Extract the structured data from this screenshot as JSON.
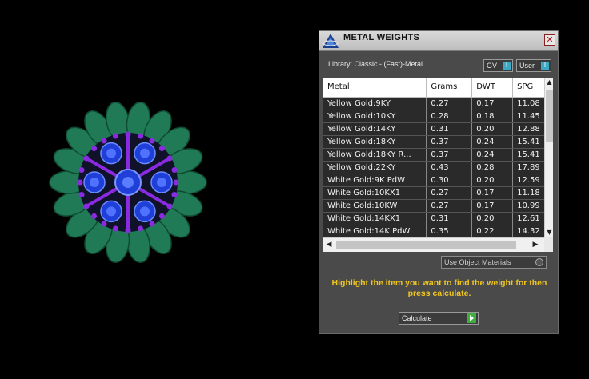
{
  "panel": {
    "title": "METAL WEIGHTS",
    "close_icon": "close-icon",
    "library_label": "Library: Classic - (Fast)-Metal",
    "toggles": [
      {
        "label": "GV",
        "state_glyph": "I"
      },
      {
        "label": "User",
        "state_glyph": "I"
      }
    ],
    "table": {
      "headers": [
        "Metal",
        "Grams",
        "DWT",
        "SPG"
      ],
      "rows": [
        [
          "Yellow Gold:9KY",
          "0.27",
          "0.17",
          "11.08"
        ],
        [
          "Yellow Gold:10KY",
          "0.28",
          "0.18",
          "11.45"
        ],
        [
          "Yellow Gold:14KY",
          "0.31",
          "0.20",
          "12.88"
        ],
        [
          "Yellow Gold:18KY",
          "0.37",
          "0.24",
          "15.41"
        ],
        [
          "Yellow Gold:18KY R...",
          "0.37",
          "0.24",
          "15.41"
        ],
        [
          "Yellow Gold:22KY",
          "0.43",
          "0.28",
          "17.89"
        ],
        [
          "White Gold:9K PdW",
          "0.30",
          "0.20",
          "12.59"
        ],
        [
          "White Gold:10KX1",
          "0.27",
          "0.17",
          "11.18"
        ],
        [
          "White Gold:10KW",
          "0.27",
          "0.17",
          "10.99"
        ],
        [
          "White Gold:14KX1",
          "0.31",
          "0.20",
          "12.61"
        ],
        [
          "White Gold:14K PdW",
          "0.35",
          "0.22",
          "14.32"
        ]
      ]
    },
    "use_materials_label": "Use Object Materials",
    "instruction": "Highlight the item you want to find the weight for then press calculate.",
    "calculate_label": "Calculate"
  },
  "colors": {
    "instruction_text": "#f0c51e",
    "toggle_accent": "#3ba8c4",
    "calculate_accent": "#3fae3f",
    "gem_blue": "#1f3fd8",
    "leaf_green": "#1f7a55",
    "prong_purple": "#8a2be2"
  }
}
